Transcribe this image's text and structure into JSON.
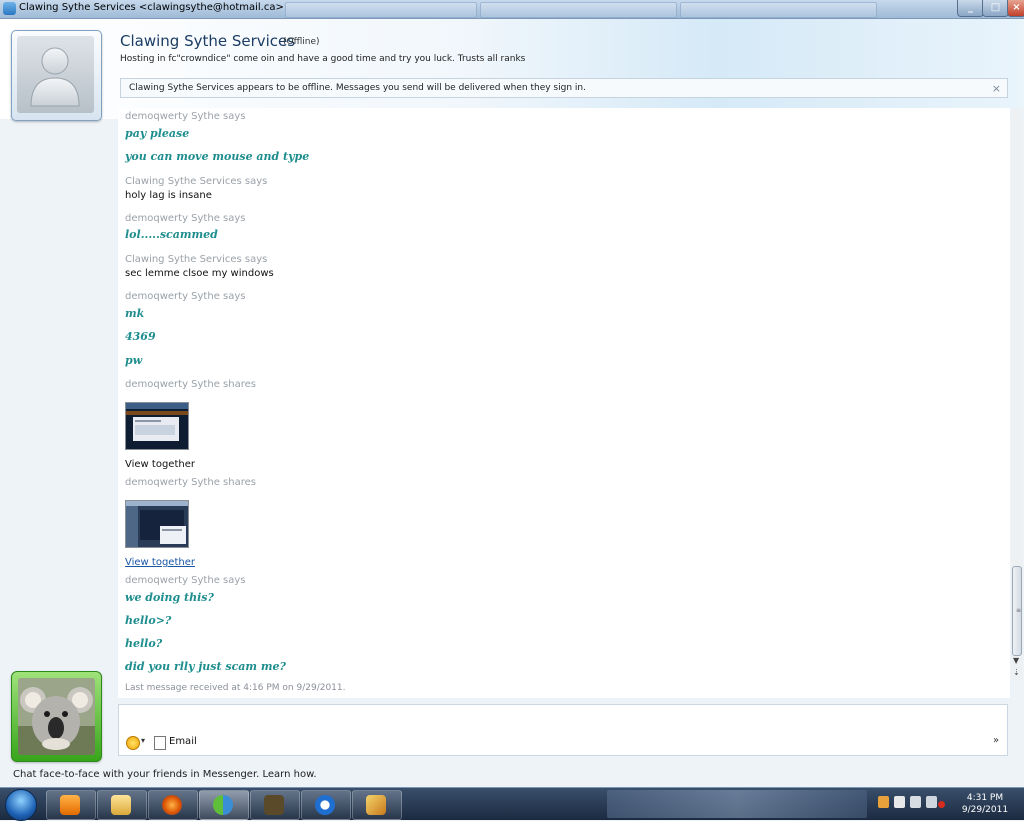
{
  "window": {
    "title": "Clawing Sythe Services <clawingsythe@hotmail.ca>",
    "minimize_label": "_",
    "maximize_label": "□",
    "close_label": "×"
  },
  "header": {
    "contact_name": "Clawing Sythe Services",
    "contact_status": "(Offline)",
    "personal_message": "Hosting in fc\"crowndice\" come oin and have a good time and try you luck. Trusts all ranks",
    "info_bar": "Clawing Sythe Services appears to be offline. Messages you send will be delivered when they sign in.",
    "info_close": "×"
  },
  "conversation": {
    "messages": [
      {
        "sender": "demoqwerty Sythe says",
        "lines": [
          "pay please",
          "you can move mouse and type"
        ],
        "style": "hand"
      },
      {
        "sender": "Clawing Sythe Services says",
        "lines": [
          "holy lag is insane"
        ],
        "style": "plain"
      },
      {
        "sender": "demoqwerty Sythe says",
        "lines": [
          "lol.....scammed"
        ],
        "style": "hand"
      },
      {
        "sender": "Clawing Sythe Services says",
        "lines": [
          "sec lemme clsoe my windows"
        ],
        "style": "plain"
      },
      {
        "sender": "demoqwerty Sythe says",
        "lines": [
          "mk",
          "4369",
          "pw"
        ],
        "style": "hand"
      },
      {
        "sender": "demoqwerty Sythe shares",
        "share_label": "View together",
        "share_is_link": false
      },
      {
        "sender": "demoqwerty Sythe shares",
        "share_label": "View together",
        "share_is_link": true
      },
      {
        "sender": "demoqwerty Sythe says",
        "lines": [
          "we doing this?",
          "hello>?",
          "hello?",
          "did you rlly just scam me?"
        ],
        "style": "hand"
      }
    ],
    "last_received": "Last message received at 4:16 PM on 9/29/2011."
  },
  "compose": {
    "email_label": "Email",
    "more_label": "»"
  },
  "promo": "Chat face-to-face with your friends in Messenger. Learn how.",
  "taskbar": {
    "clock_time": "4:31 PM",
    "clock_date": "9/29/2011",
    "apps": [
      "media-player-icon",
      "explorer-icon",
      "firefox-icon",
      "messenger-icon",
      "runescape-icon",
      "teamviewer-icon",
      "paint-icon"
    ]
  },
  "colors": {
    "handwriting": "#1e8d8e",
    "sender_gray": "#9aa1a8",
    "link_blue": "#1a56a6"
  }
}
